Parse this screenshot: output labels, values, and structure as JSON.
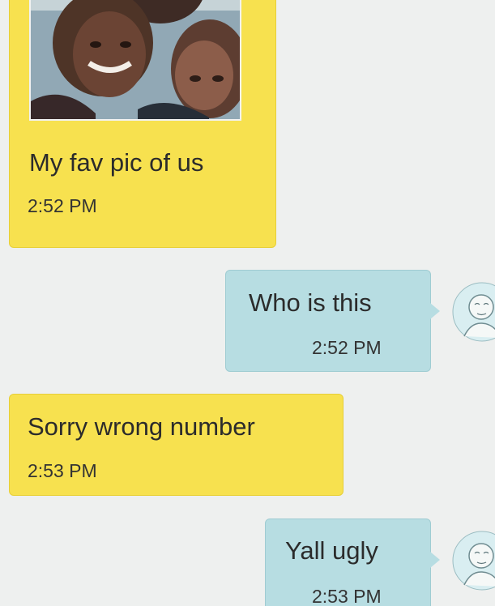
{
  "messages": [
    {
      "direction": "incoming",
      "text": "My fav pic of us",
      "time": "2:52 PM",
      "has_photo": true
    },
    {
      "direction": "outgoing",
      "text": "Who is this",
      "time": "2:52 PM"
    },
    {
      "direction": "incoming",
      "text": "Sorry wrong number",
      "time": "2:53 PM"
    },
    {
      "direction": "outgoing",
      "text": "Yall ugly",
      "time": "2:53 PM"
    }
  ],
  "colors": {
    "incoming_bubble": "#f7e14f",
    "outgoing_bubble": "#b7dde2",
    "background": "#eef0ef",
    "text": "#2b2b2b"
  },
  "icons": {
    "avatar": "default-contact-avatar-icon"
  }
}
